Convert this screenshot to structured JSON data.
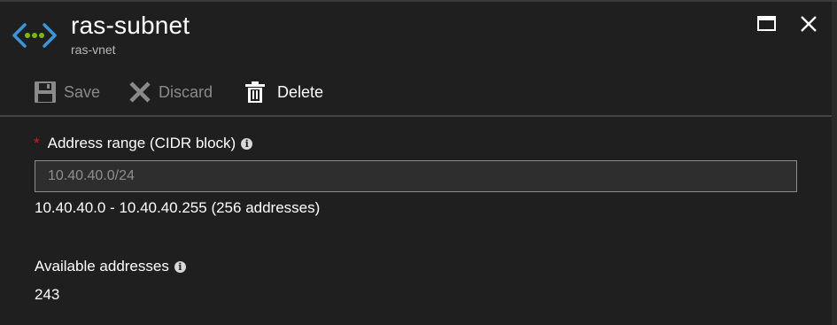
{
  "blade": {
    "title": "ras-subnet",
    "subtitle": "ras-vnet",
    "icon": "subnet-icon",
    "window_controls": [
      {
        "icon": "maximize-icon"
      },
      {
        "icon": "close-icon"
      }
    ]
  },
  "toolbar": {
    "save_label": "Save",
    "save_icon": "save-icon",
    "save_enabled": false,
    "discard_label": "Discard",
    "discard_icon": "discard-icon",
    "discard_enabled": false,
    "delete_label": "Delete",
    "delete_icon": "trash-icon",
    "delete_enabled": true
  },
  "form": {
    "address_range": {
      "label": "Address range (CIDR block)",
      "required": true,
      "required_marker": "*",
      "info_icon": "info-icon",
      "value": "10.40.40.0/24",
      "range_summary": "10.40.40.0 - 10.40.40.255 (256 addresses)"
    },
    "available_addresses": {
      "label": "Available addresses",
      "info_icon": "info-icon",
      "value": "243"
    }
  },
  "colors": {
    "background": "#1f1f1f",
    "text": "#ffffff",
    "disabled_text": "#8a8a8a",
    "required": "#e81123",
    "icon_blue": "#3a96dd",
    "icon_green": "#7fba00"
  }
}
